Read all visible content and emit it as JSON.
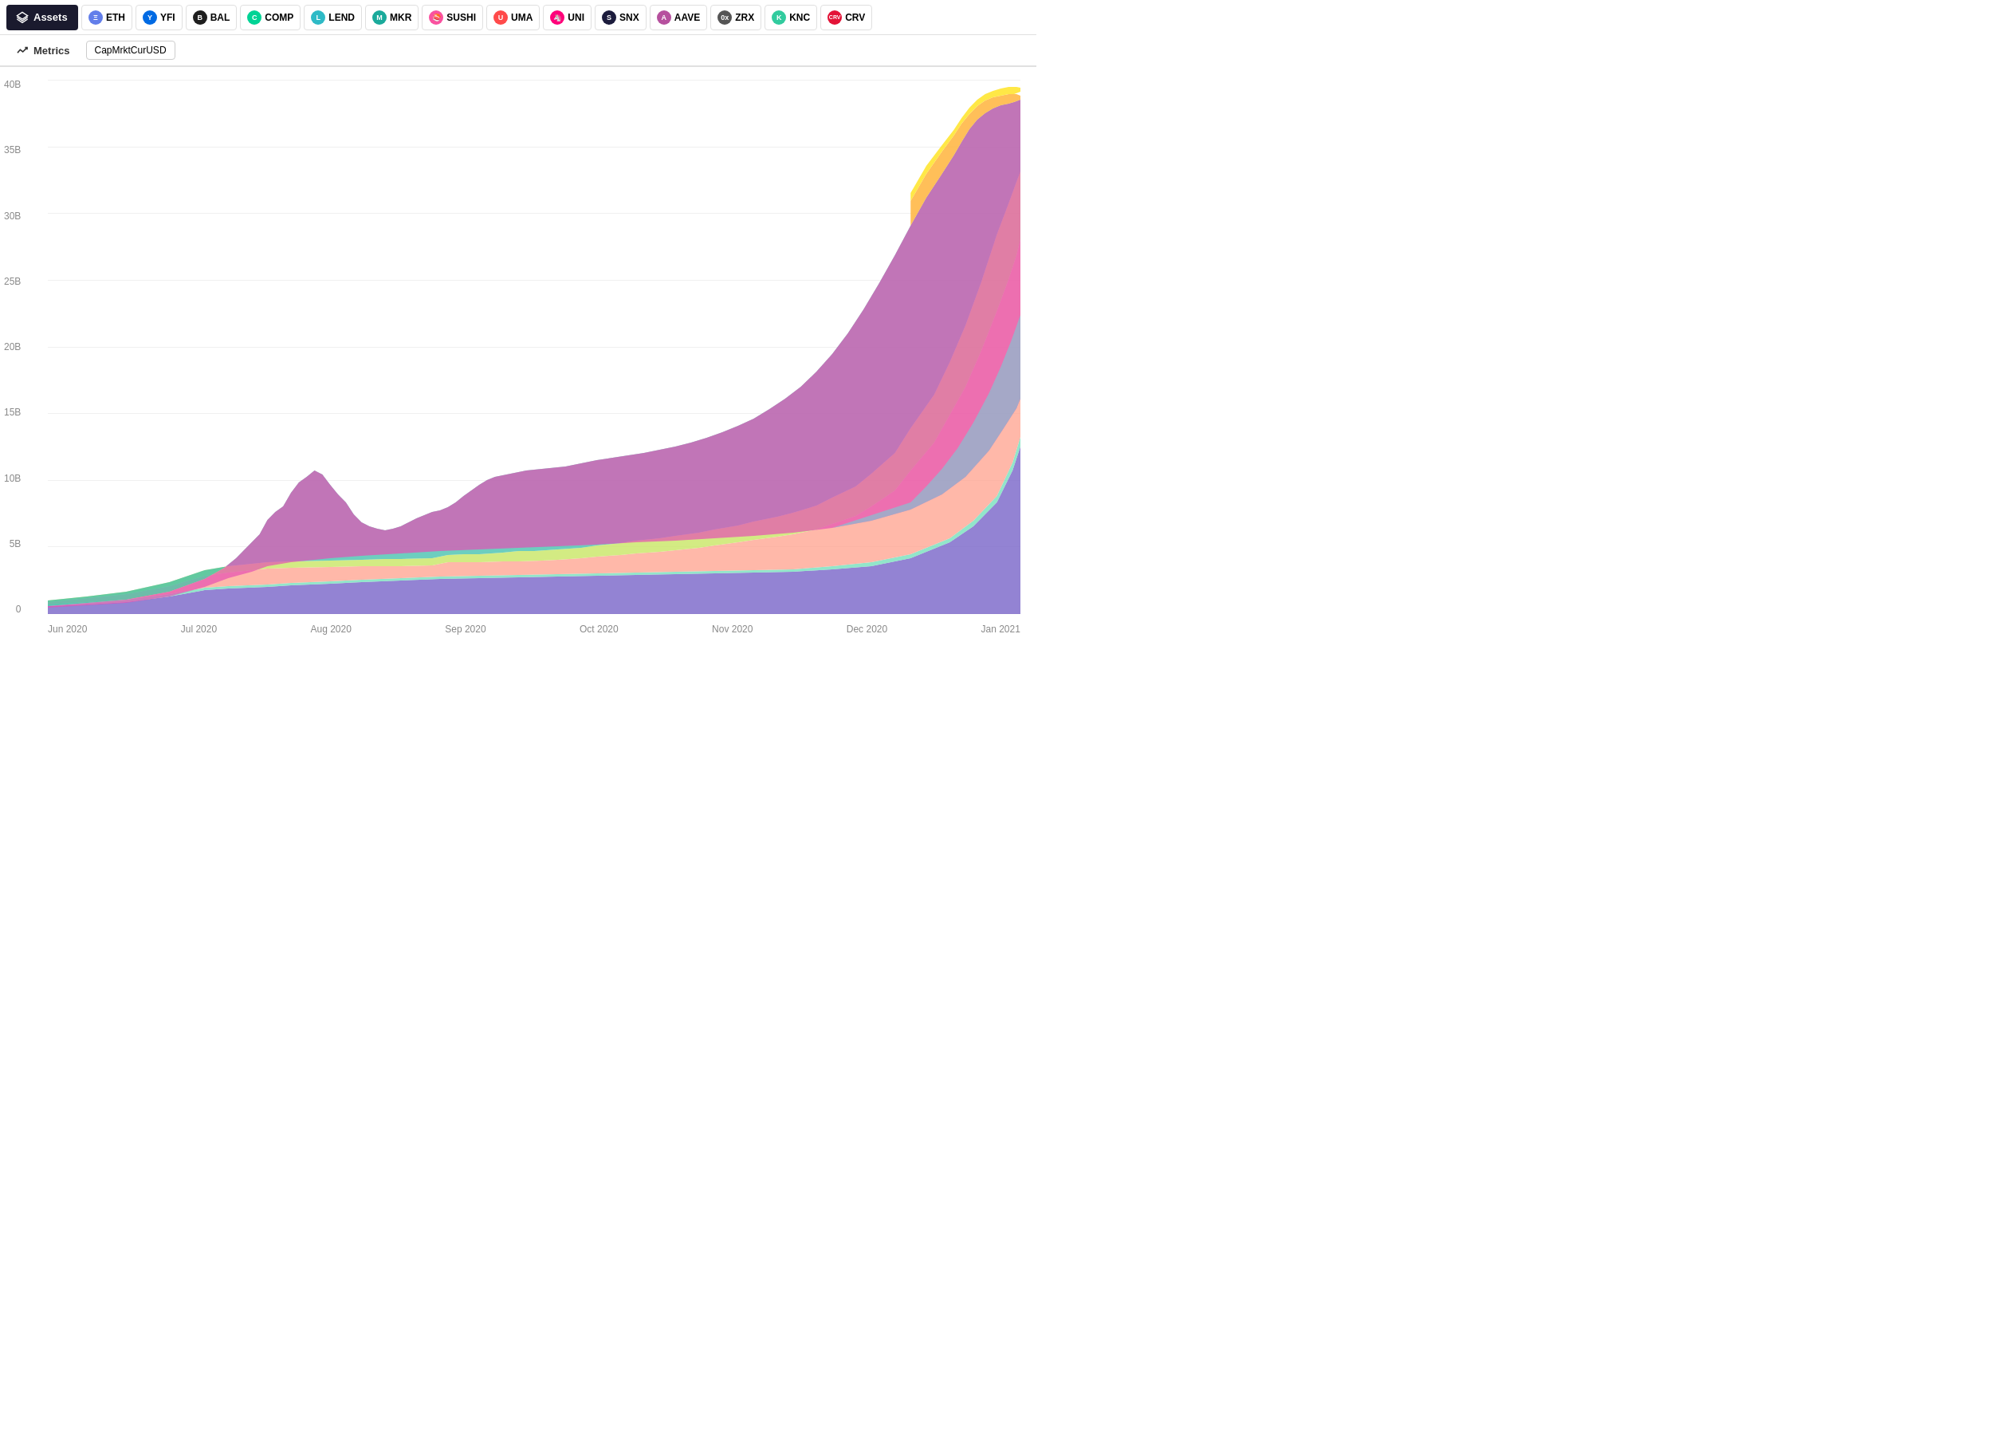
{
  "header": {
    "assets_label": "Assets",
    "metrics_label": "Metrics",
    "metric_tag": "CapMrktCurUSD"
  },
  "assets": [
    {
      "symbol": "ETH",
      "color": "#627eea",
      "bg": "#627eea"
    },
    {
      "symbol": "YFI",
      "color": "#006ae3",
      "bg": "#006ae3"
    },
    {
      "symbol": "BAL",
      "color": "#1e1e1e",
      "bg": "#1e1e1e"
    },
    {
      "symbol": "COMP",
      "color": "#00d395",
      "bg": "#00d395"
    },
    {
      "symbol": "LEND",
      "color": "#2ebac6",
      "bg": "#2ebac6"
    },
    {
      "symbol": "MKR",
      "color": "#1aaa9b",
      "bg": "#1aaa9b"
    },
    {
      "symbol": "SUSHI",
      "color": "#fa52a0",
      "bg": "#fa52a0"
    },
    {
      "symbol": "UMA",
      "color": "#ff4a4a",
      "bg": "#ff4a4a"
    },
    {
      "symbol": "UNI",
      "color": "#ff007a",
      "bg": "#ff007a"
    },
    {
      "symbol": "SNX",
      "color": "#1c1c3d",
      "bg": "#1c1c3d"
    },
    {
      "symbol": "AAVE",
      "color": "#b6509e",
      "bg": "#b6509e"
    },
    {
      "symbol": "ZRX",
      "color": "#302c2c",
      "bg": "#302c2c"
    },
    {
      "symbol": "KNC",
      "color": "#31cb9e",
      "bg": "#31cb9e"
    },
    {
      "symbol": "CRV",
      "color": "#e31337",
      "bg": "#e31337"
    }
  ],
  "y_axis": {
    "labels": [
      "0",
      "5B",
      "10B",
      "15B",
      "20B",
      "25B",
      "30B",
      "35B",
      "40B"
    ]
  },
  "x_axis": {
    "labels": [
      "Jun 2020",
      "Jul 2020",
      "Aug 2020",
      "Sep 2020",
      "Oct 2020",
      "Nov 2020",
      "Dec 2020",
      "Jan 2021"
    ]
  }
}
